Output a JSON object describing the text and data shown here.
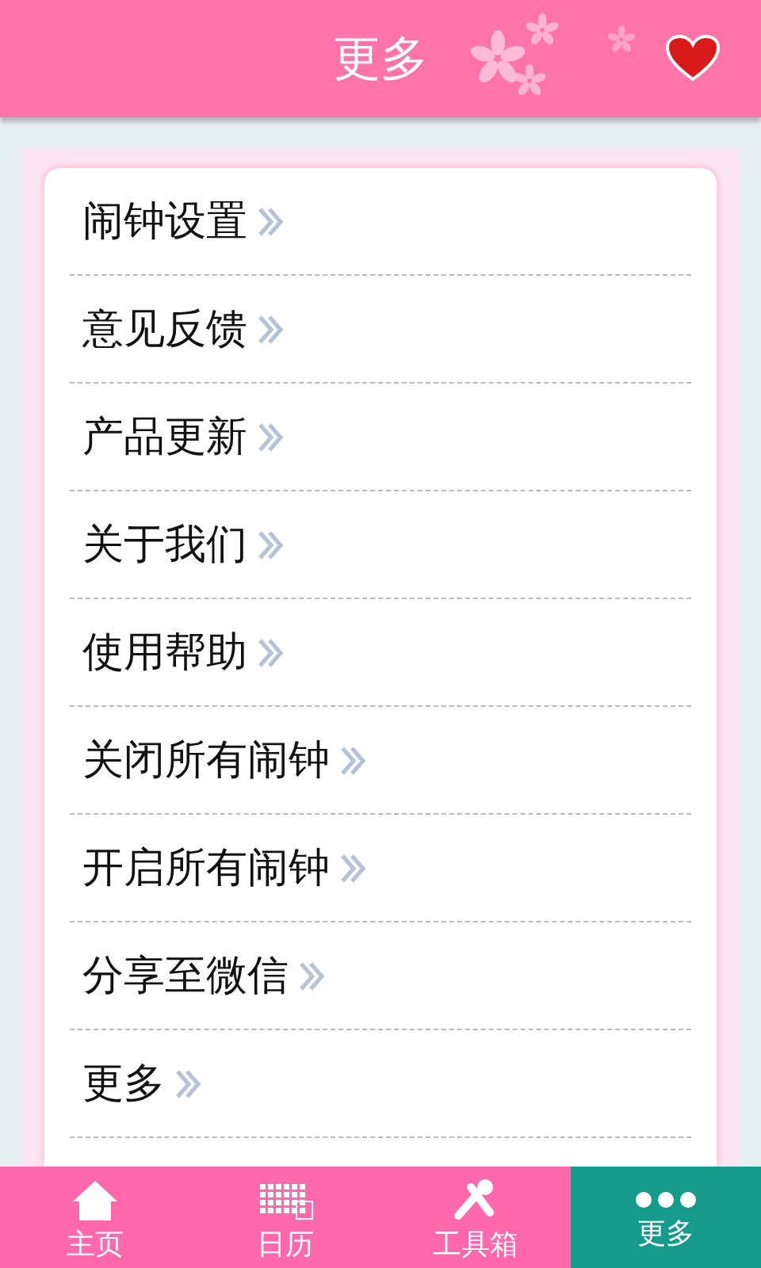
{
  "header": {
    "title": "更多"
  },
  "menu": [
    {
      "label": "闹钟设置"
    },
    {
      "label": "意见反馈"
    },
    {
      "label": "产品更新"
    },
    {
      "label": "关于我们"
    },
    {
      "label": "使用帮助"
    },
    {
      "label": "关闭所有闹钟"
    },
    {
      "label": "开启所有闹钟"
    },
    {
      "label": "分享至微信"
    },
    {
      "label": "更多"
    }
  ],
  "tabs": [
    {
      "kind": "home",
      "label": "主页",
      "selected": false
    },
    {
      "kind": "calendar",
      "label": "日历",
      "selected": false
    },
    {
      "kind": "tools",
      "label": "工具箱",
      "selected": false
    },
    {
      "kind": "more",
      "label": "更多",
      "selected": true
    }
  ]
}
